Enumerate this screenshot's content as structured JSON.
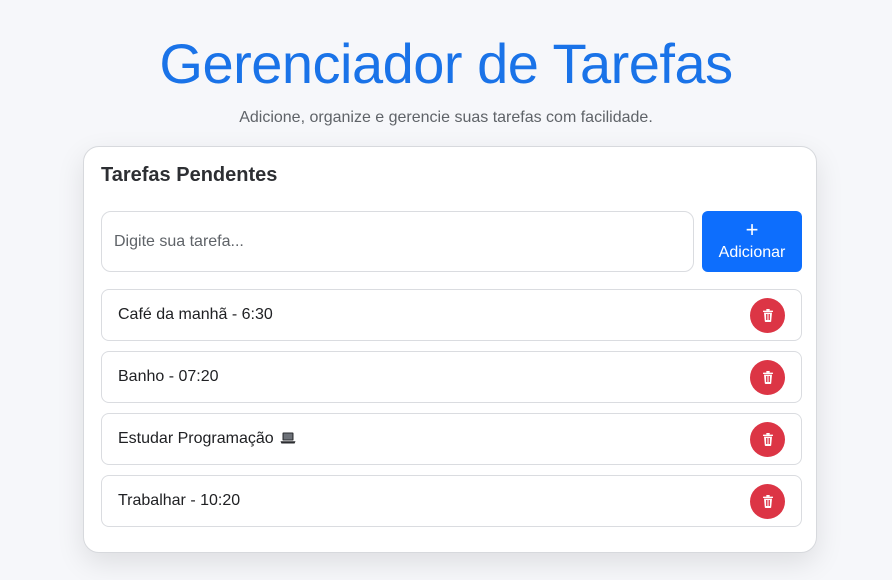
{
  "header": {
    "title": "Gerenciador de Tarefas",
    "subtitle": "Adicione, organize e gerencie suas tarefas com facilidade."
  },
  "card": {
    "title": "Tarefas Pendentes",
    "input": {
      "placeholder": "Digite sua tarefa...",
      "value": ""
    },
    "add_button": {
      "icon": "plus-icon",
      "label": "Adicionar"
    }
  },
  "tasks": [
    {
      "text": "Café da manhã - 6:30",
      "icon": null
    },
    {
      "text": "Banho - 07:20",
      "icon": null
    },
    {
      "text": "Estudar Programação",
      "icon": "laptop-icon"
    },
    {
      "text": "Trabalhar - 10:20",
      "icon": null
    }
  ],
  "colors": {
    "title": "#1a73e8",
    "primary_button": "#0d6efd",
    "delete_button": "#dc3545",
    "background": "#f6f7fa"
  },
  "icons": {
    "delete": "trash-icon"
  }
}
